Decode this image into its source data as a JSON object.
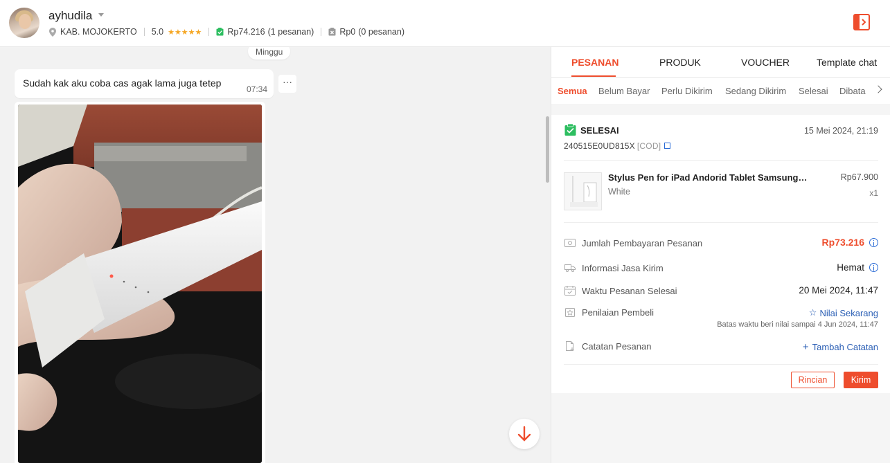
{
  "header": {
    "username": "ayhudila",
    "location": "KAB. MOJOKERTO",
    "rating": "5.0",
    "stats": [
      {
        "amount": "Rp74.216",
        "count": "(1 pesanan)"
      },
      {
        "amount": "Rp0",
        "count": "(0 pesanan)"
      }
    ]
  },
  "chat": {
    "day_label": "Minggu",
    "messages": [
      {
        "text": "Sudah kak aku coba cas agak lama juga tetep",
        "time": "07:34"
      }
    ],
    "more_label": "···"
  },
  "panel": {
    "tabs": [
      "PESANAN",
      "PRODUK",
      "VOUCHER",
      "Template chat"
    ],
    "subtabs": [
      "Semua",
      "Belum Bayar",
      "Perlu Dikirim",
      "Sedang Dikirim",
      "Selesai",
      "Dibata"
    ],
    "order": {
      "status": "SELESAI",
      "date": "15 Mei 2024, 21:19",
      "id": "240515E0UD815X",
      "payment_tag": "[COD]",
      "product": {
        "name": "Stylus Pen for iPad Andorid Tablet Samsung…",
        "variant": "White",
        "price": "Rp67.900",
        "qty": "x1"
      },
      "rows": [
        {
          "label": "Jumlah Pembayaran Pesanan",
          "value": "Rp73.216"
        },
        {
          "label": "Informasi Jasa Kirim",
          "value": "Hemat"
        },
        {
          "label": "Waktu Pesanan Selesai",
          "value": "20 Mei 2024, 11:47"
        },
        {
          "label": "Penilaian Pembeli",
          "value": "Nilai Sekarang",
          "note": "Batas waktu beri nilai sampai 4 Jun 2024, 11:47"
        },
        {
          "label": "Catatan Pesanan",
          "value": "Tambah Catatan"
        }
      ],
      "buttons": {
        "detail": "Rincian",
        "send": "Kirim"
      }
    }
  },
  "colors": {
    "accent": "#ee4d2d",
    "link": "#2b5fb5",
    "success": "#2dbe60",
    "star": "#f5a623"
  },
  "icons": [
    "location-pin-icon",
    "star-icon",
    "order-check-icon",
    "order-cancel-icon",
    "exit-panel-icon",
    "more-icon",
    "arrow-down-icon",
    "chevron-right-icon",
    "clipboard-check-icon",
    "copy-icon",
    "payment-icon",
    "truck-icon",
    "calendar-icon",
    "rating-icon",
    "note-icon",
    "info-icon",
    "plus-icon"
  ]
}
